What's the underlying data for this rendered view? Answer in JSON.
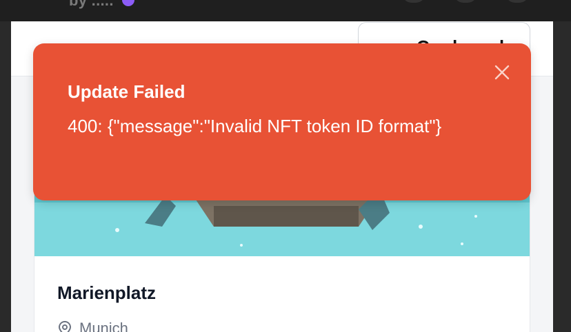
{
  "header": {
    "byline": "by ....."
  },
  "page_bar": {
    "pill_label": "Cards and"
  },
  "card": {
    "title": "Marienplatz",
    "location": "Munich",
    "location_icon": "map-pin-icon"
  },
  "toast": {
    "title": "Update Failed",
    "message": "400: {\"message\":\"Invalid NFT token ID format\"}",
    "close_icon": "close-icon",
    "background": "#e85235"
  }
}
